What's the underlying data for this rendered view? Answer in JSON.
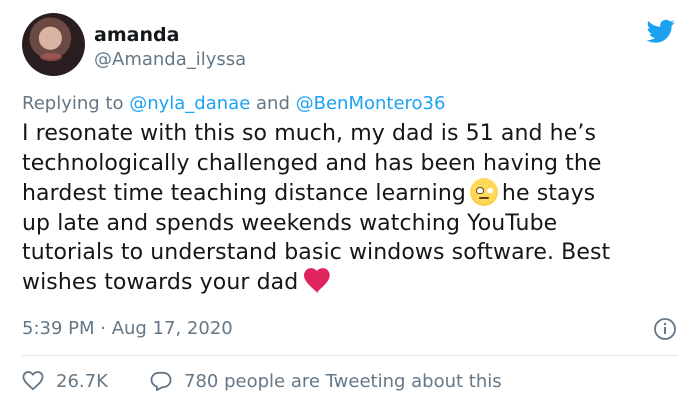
{
  "user": {
    "name": "amanda",
    "handle": "@Amanda_ilyssa"
  },
  "reply": {
    "prefix": "Replying to",
    "mention1": "@nyla_danae",
    "conjunction": "and",
    "mention2": "@BenMontero36"
  },
  "tweet": {
    "line1": "I resonate with this so much, my dad is 51 and he’s",
    "line2": "technologically challenged and has been having the",
    "line3a": "hardest time teaching distance learning",
    "line3b": "he stays",
    "line4": "up late and spends weekends watching YouTube",
    "line5": "tutorials to understand basic windows software. Best",
    "line6": "wishes towards your dad",
    "emoji1": "rolling-eyes-emoji",
    "emoji2": "red-heart-emoji"
  },
  "timestamp": "5:39 PM · Aug 17, 2020",
  "stats": {
    "likes": "26.7K",
    "conversation": "780 people are Tweeting about this"
  },
  "colors": {
    "brand": "#1da1f2",
    "secondary_text": "#657786",
    "heart": "#e0245e"
  },
  "icons": {
    "brand": "twitter-bird-icon",
    "info": "info-icon",
    "like": "heart-outline-icon",
    "reply": "speech-bubble-icon"
  }
}
